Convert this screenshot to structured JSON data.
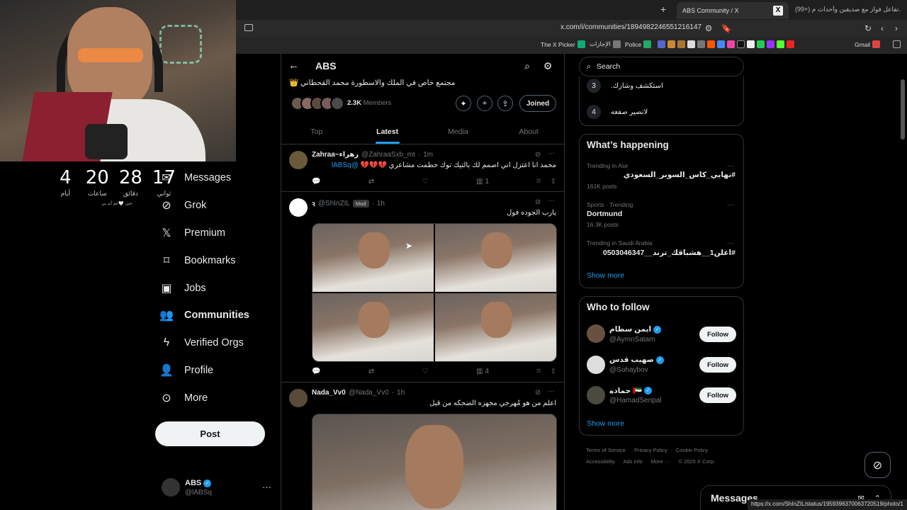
{
  "stream": {
    "countdown": [
      {
        "value": "4",
        "label": "أيام"
      },
      {
        "value": "20",
        "label": "ساعات"
      },
      {
        "value": "28",
        "label": "دقائق"
      },
      {
        "value": "17",
        "label": "ثواني"
      }
    ],
    "note": "حتى 🤍عم أبد بي"
  },
  "browser": {
    "active_tab": "ABS Community / X",
    "other_tab": "(99+) تفاعل فواز مع صديقين وأحداث م...",
    "url": "x.com/i/communities/1894982246551216147",
    "bookmarks": [
      "The X Picker",
      "الإجازات",
      "Police",
      "Gmail"
    ],
    "status_url": "https://x.com/ShInZIL/status/1959396370063720519/photo/1"
  },
  "sidebar": {
    "items": [
      {
        "label": "Messages",
        "icon": "envelope-icon"
      },
      {
        "label": "Grok",
        "icon": "grok-icon"
      },
      {
        "label": "Premium",
        "icon": "x-logo-icon"
      },
      {
        "label": "Bookmarks",
        "icon": "bookmark-icon"
      },
      {
        "label": "Jobs",
        "icon": "briefcase-icon"
      },
      {
        "label": "Communities",
        "icon": "people-icon"
      },
      {
        "label": "Verified Orgs",
        "icon": "lightning-icon"
      },
      {
        "label": "Profile",
        "icon": "person-icon"
      },
      {
        "label": "More",
        "icon": "more-circle-icon"
      }
    ],
    "post_label": "Post",
    "account": {
      "name": "ABS",
      "handle": "@lABSq"
    }
  },
  "community": {
    "title": "ABS",
    "description": "مجتمع خاص في الملك والاسطورة محمد القحطاني 👑",
    "member_count": "2.3K",
    "members_label": "Members",
    "joined_label": "Joined",
    "tabs": [
      "Top",
      "Latest",
      "Media",
      "About"
    ],
    "active_tab": "Latest"
  },
  "posts": [
    {
      "name": "Zahraa~زهراء",
      "handle": "@ZahraaSxb_mt",
      "time": "1m",
      "text": "محمد انا اعتزل اني اصمم لك بالتيك توك حطمت مشاعري 💔💔💔",
      "mention": "@lABSq",
      "views": "1"
    },
    {
      "name": "ꝛ",
      "handle": "@ShInZIL",
      "badge": "Mod",
      "time": "1h",
      "text": "يارب الجوده فول",
      "views": "4"
    },
    {
      "name": "Nada_Vv0",
      "handle": "@Nada_Vv0",
      "time": "1h",
      "text": "اعلم من هو مُهرجي مجهزه الضحكه من قبل"
    }
  ],
  "right": {
    "search_placeholder": "Search",
    "rules": [
      {
        "num": "3",
        "text": "استكشف وشارك."
      },
      {
        "num": "4",
        "text": "لاتصير صفعه"
      }
    ],
    "happening_title": "What’s happening",
    "trends": [
      {
        "context": "Trending in Asir",
        "name": "#نهايي_كاس_السوبر_السعودي",
        "count": "161K posts",
        "rtl": true
      },
      {
        "context": "Sports · Trending",
        "name": "Dortmund",
        "count": "16.3K posts",
        "rtl": false
      },
      {
        "context": "Trending in Saudi Arabia",
        "name": "#اعلن1__هشباقك_ترند__0503046347",
        "count": "",
        "rtl": true
      }
    ],
    "show_more": "Show more",
    "wtf_title": "Who to follow",
    "follow_label": "Follow",
    "who_to_follow": [
      {
        "name": "ايمن سطام",
        "handle": "@AymnSatam"
      },
      {
        "name": "صهيب قدس",
        "handle": "@Sohaybov"
      },
      {
        "name": "حماده 🇦🇪",
        "handle": "@HamadSenpal"
      }
    ],
    "footer": [
      "Terms of Service",
      "Privacy Policy",
      "Cookie Policy",
      "Accessibility",
      "Ads info",
      "More ···",
      "© 2025 X Corp."
    ],
    "messages_label": "Messages"
  },
  "colors": {
    "accent": "#1d9bf0",
    "background": "#000000",
    "border": "#2f3336",
    "muted": "#71767b"
  }
}
